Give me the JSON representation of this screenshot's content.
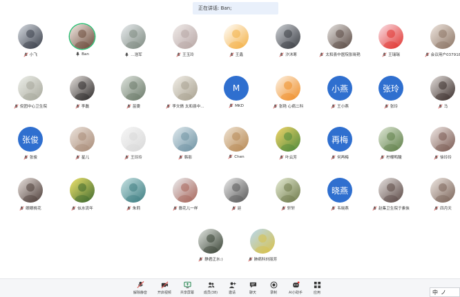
{
  "banner": {
    "text": "正在讲话: Ban;"
  },
  "colors": {
    "accent_text_avatar": "#2f6fcf",
    "muted_mic": "#d9534f",
    "active_ring": "#2bbf74"
  },
  "participants": [
    {
      "name": "小飞",
      "mic": "muted",
      "avatar": "photo",
      "c1": "#d8dde3",
      "c2": "#3a3f4a"
    },
    {
      "name": "Ban",
      "mic": "active",
      "avatar": "photo",
      "c1": "#f4ece6",
      "c2": "#6b4a3a",
      "active": true
    },
    {
      "name": "...浩军",
      "mic": "active",
      "avatar": "photo",
      "c1": "#e9ecef",
      "c2": "#7e8a80"
    },
    {
      "name": "王玉玲",
      "mic": "muted",
      "avatar": "photo",
      "c1": "#f1eceb",
      "c2": "#b7a6a4"
    },
    {
      "name": "王鑫",
      "mic": "muted",
      "avatar": "photo",
      "c1": "#ffffff",
      "c2": "#f3b045"
    },
    {
      "name": "汐沐寒",
      "mic": "muted",
      "avatar": "photo",
      "c1": "#cfd2d6",
      "c2": "#3c3f45"
    },
    {
      "name": "太和县中医院张晓艳",
      "mic": "muted",
      "avatar": "photo",
      "c1": "#e7e4e1",
      "c2": "#5b4b45"
    },
    {
      "name": "王瑞瑞",
      "mic": "muted",
      "avatar": "photo",
      "c1": "#fbe4ea",
      "c2": "#e0332f"
    },
    {
      "name": "会议用户037918",
      "mic": "muted",
      "avatar": "photo",
      "c1": "#efe6df",
      "c2": "#8c7565"
    },
    {
      "name": "倪团中心卫生院",
      "mic": "muted",
      "avatar": "photo",
      "c1": "#eef0ea",
      "c2": "#a7a89c"
    },
    {
      "name": "李磊",
      "mic": "muted",
      "avatar": "photo",
      "c1": "#e7e2de",
      "c2": "#2d2a2a"
    },
    {
      "name": "苗雯",
      "mic": "muted",
      "avatar": "photo",
      "c1": "#dfe4de",
      "c2": "#6b7a69"
    },
    {
      "name": "李文倩 太和县中...",
      "mic": "muted",
      "avatar": "photo",
      "c1": "#f2efe8",
      "c2": "#a8a190"
    },
    {
      "name": "MKD",
      "mic": "muted",
      "avatar": "text",
      "text": "M"
    },
    {
      "name": "张艳 心病二科",
      "mic": "muted",
      "avatar": "photo",
      "c1": "#fdf2e4",
      "c2": "#ef8f2a"
    },
    {
      "name": "王小燕",
      "mic": "muted",
      "avatar": "text",
      "text": "小燕"
    },
    {
      "name": "张玲",
      "mic": "muted",
      "avatar": "text",
      "text": "张玲"
    },
    {
      "name": "马",
      "mic": "muted",
      "avatar": "photo",
      "c1": "#e5dfdc",
      "c2": "#3b2f2c"
    },
    {
      "name": "张俊",
      "mic": "muted",
      "avatar": "text",
      "text": "张俊"
    },
    {
      "name": "星儿",
      "mic": "muted",
      "avatar": "photo",
      "c1": "#ece3dc",
      "c2": "#a98c78"
    },
    {
      "name": "王玲玲",
      "mic": "muted",
      "avatar": "photo",
      "c1": "#f6f6f6",
      "c2": "#d9d9d9"
    },
    {
      "name": "韩影",
      "mic": "muted",
      "avatar": "photo",
      "c1": "#dfe9ee",
      "c2": "#6f93a3"
    },
    {
      "name": "Chen",
      "mic": "muted",
      "avatar": "photo",
      "c1": "#efe3d2",
      "c2": "#b78955"
    },
    {
      "name": "叶云芳",
      "mic": "muted",
      "avatar": "photo",
      "c1": "#f3d66b",
      "c2": "#4f8a3a"
    },
    {
      "name": "何再梅",
      "mic": "muted",
      "avatar": "text",
      "text": "再梅"
    },
    {
      "name": "柠檬鸭酸",
      "mic": "muted",
      "avatar": "photo",
      "c1": "#dfe8d6",
      "c2": "#5f7f49"
    },
    {
      "name": "徐玲玲",
      "mic": "muted",
      "avatar": "photo",
      "c1": "#f1e9e6",
      "c2": "#7a5a52"
    },
    {
      "name": "眼眼桃花",
      "mic": "muted",
      "avatar": "photo",
      "c1": "#e9e1dd",
      "c2": "#4e3f3a"
    },
    {
      "name": "似水流年",
      "mic": "muted",
      "avatar": "photo",
      "c1": "#f1e56e",
      "c2": "#3f6a2e"
    },
    {
      "name": "朱莉",
      "mic": "muted",
      "avatar": "photo",
      "c1": "#c7e2e3",
      "c2": "#3f7e82"
    },
    {
      "name": "傲花儿一样",
      "mic": "muted",
      "avatar": "photo",
      "c1": "#eceef0",
      "c2": "#a7655a"
    },
    {
      "name": "廷",
      "mic": "muted",
      "avatar": "photo",
      "c1": "#eaeaea",
      "c2": "#5a5a5a"
    },
    {
      "name": "轩轩",
      "mic": "muted",
      "avatar": "photo",
      "c1": "#e7edd5",
      "c2": "#6f7a4b"
    },
    {
      "name": "韦晓燕",
      "mic": "muted",
      "avatar": "text",
      "text": "晓燕"
    },
    {
      "name": "赵集卫生院于素侠",
      "mic": "muted",
      "avatar": "photo",
      "c1": "#e7e2e0",
      "c2": "#5c4a46"
    },
    {
      "name": "四月天",
      "mic": "muted",
      "avatar": "photo",
      "c1": "#efe8e3",
      "c2": "#7b6459"
    },
    {
      "name": "静君正水:)",
      "mic": "muted",
      "avatar": "photo",
      "c1": "#e1e5e0",
      "c2": "#3b4537"
    },
    {
      "name": "肺病科刘丽芳",
      "mic": "muted",
      "avatar": "photo",
      "c1": "#b9d8ef",
      "c2": "#d7c14b"
    }
  ],
  "toolbar": {
    "items": [
      {
        "label": "解除静音",
        "icon": "mic-muted-icon"
      },
      {
        "label": "开启视频",
        "icon": "camera-off-icon"
      },
      {
        "label": "共享屏幕",
        "icon": "share-screen-icon"
      },
      {
        "label": "成员(38)",
        "icon": "members-icon"
      },
      {
        "label": "邀请",
        "icon": "invite-icon"
      },
      {
        "label": "聊天",
        "icon": "chat-icon"
      },
      {
        "label": "录制",
        "icon": "record-icon"
      },
      {
        "label": "AI小助手",
        "icon": "ai-assistant-icon"
      },
      {
        "label": "应用",
        "icon": "apps-icon"
      }
    ]
  },
  "chat_input": {
    "placeholder": "..."
  },
  "ime": {
    "mode": "中",
    "punct": "ノ"
  }
}
